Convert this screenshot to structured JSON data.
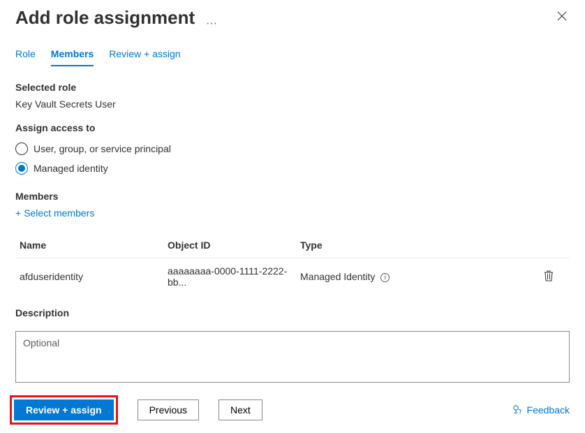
{
  "header": {
    "title": "Add role assignment"
  },
  "tabs": {
    "role": "Role",
    "members": "Members",
    "review": "Review + assign"
  },
  "sections": {
    "selected_role_label": "Selected role",
    "selected_role_value": "Key Vault Secrets User",
    "assign_access_label": "Assign access to",
    "assign_opt_user": "User, group, or service principal",
    "assign_opt_mi": "Managed identity",
    "members_label": "Members",
    "select_members_link": "Select members",
    "description_label": "Description",
    "description_placeholder": "Optional"
  },
  "table": {
    "head_name": "Name",
    "head_obj": "Object ID",
    "head_type": "Type",
    "row": {
      "name": "afduseridentity",
      "obj": "aaaaaaaa-0000-1111-2222-bb...",
      "type": "Managed Identity"
    }
  },
  "footer": {
    "review": "Review + assign",
    "previous": "Previous",
    "next": "Next",
    "feedback": "Feedback"
  }
}
